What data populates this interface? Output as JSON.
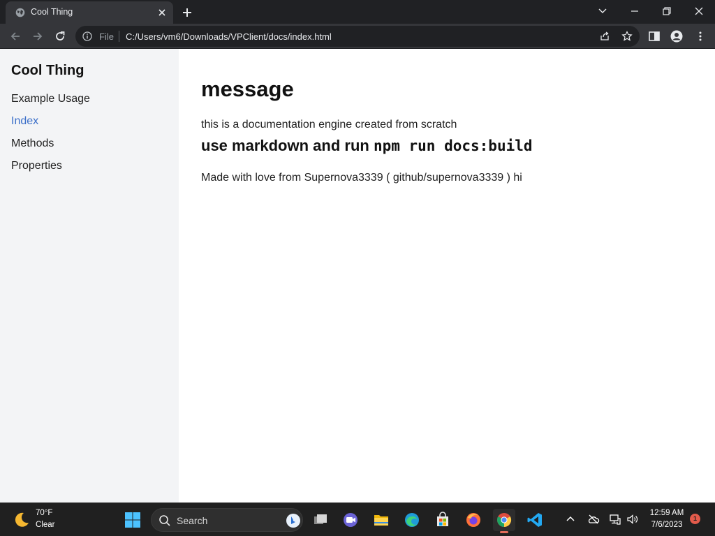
{
  "browser": {
    "tab": {
      "title": "Cool Thing"
    },
    "address": {
      "scheme": "File",
      "url": "C:/Users/vm6/Downloads/VPClient/docs/index.html"
    }
  },
  "page": {
    "site_title": "Cool Thing",
    "nav": [
      {
        "label": "Example Usage",
        "active": false
      },
      {
        "label": "Index",
        "active": true
      },
      {
        "label": "Methods",
        "active": false
      },
      {
        "label": "Properties",
        "active": false
      }
    ],
    "content": {
      "heading": "message",
      "intro": "this is a documentation engine created from scratch",
      "subheading_text": "use markdown and run ",
      "subheading_code": "npm run docs:build",
      "footer_text": "Made with love from Supernova3339 ( github/supernova3339 ) hi"
    }
  },
  "taskbar": {
    "weather": {
      "temp": "70°F",
      "condition": "Clear",
      "icon": "moon-icon"
    },
    "search": {
      "placeholder": "Search"
    },
    "apps": [
      "task-view-icon",
      "teams-icon",
      "file-explorer-icon",
      "edge-icon",
      "store-icon",
      "firefox-icon",
      "chrome-icon",
      "vscode-icon"
    ],
    "active_app": "chrome-icon",
    "clock": {
      "time": "12:59 AM",
      "date": "7/6/2023"
    },
    "notifications": "1"
  },
  "colors": {
    "sidebar_bg": "#f3f4f6",
    "active_link": "#3b6fc9",
    "chrome_dark": "#202124",
    "chrome_tab": "#35363a",
    "taskbar_bg": "#202020"
  }
}
